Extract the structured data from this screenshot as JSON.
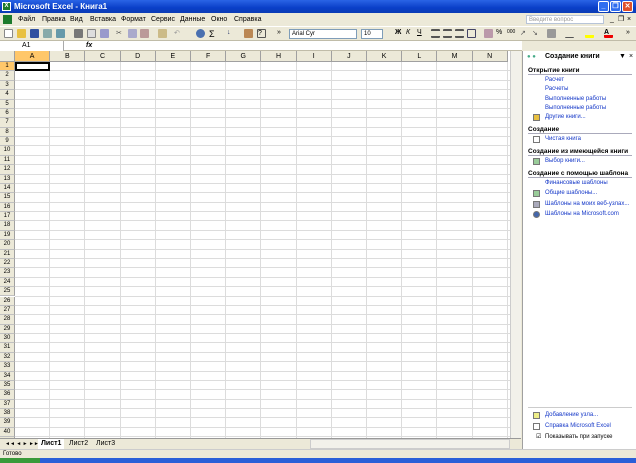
{
  "window": {
    "title": "Microsoft Excel - Книга1"
  },
  "menu": [
    "Файл",
    "Правка",
    "Вид",
    "Вставка",
    "Формат",
    "Сервис",
    "Данные",
    "Окно",
    "Справка"
  ],
  "help_placeholder": "Введите вопрос",
  "toolbar": {
    "font": "Arial Cyr",
    "size": "10",
    "bold": "Ж",
    "italic": "К",
    "underline": "Ч",
    "percent": "%",
    "thousands": "000"
  },
  "formula_bar": {
    "name_box": "A1",
    "fx": "fx"
  },
  "columns": [
    "A",
    "B",
    "C",
    "D",
    "E",
    "F",
    "G",
    "H",
    "I",
    "J",
    "K",
    "L",
    "M",
    "N"
  ],
  "sheets": [
    "Лист1",
    "Лист2",
    "Лист3"
  ],
  "status": "Готово",
  "task_pane": {
    "title": "Создание книги",
    "open_heading": "Открытие книги",
    "recent": [
      "Расчет",
      "Расчеты",
      "Выполненные работы",
      "Выполненные работы"
    ],
    "more_books": "Другие книги...",
    "create_heading": "Создание",
    "blank": "Чистая книга",
    "existing_heading": "Создание из имеющейся книги",
    "choose_book": "Выбор книги...",
    "template_heading": "Создание с помощью шаблона",
    "templates": [
      "Финансовые шаблоны",
      "Общие шаблоны...",
      "Шаблоны на моих веб-узлах...",
      "Шаблоны на Microsoft.com"
    ],
    "add_site": "Добавление узла...",
    "help": "Справка Microsoft Excel",
    "show_on_startup": "Показывать при запуске"
  }
}
